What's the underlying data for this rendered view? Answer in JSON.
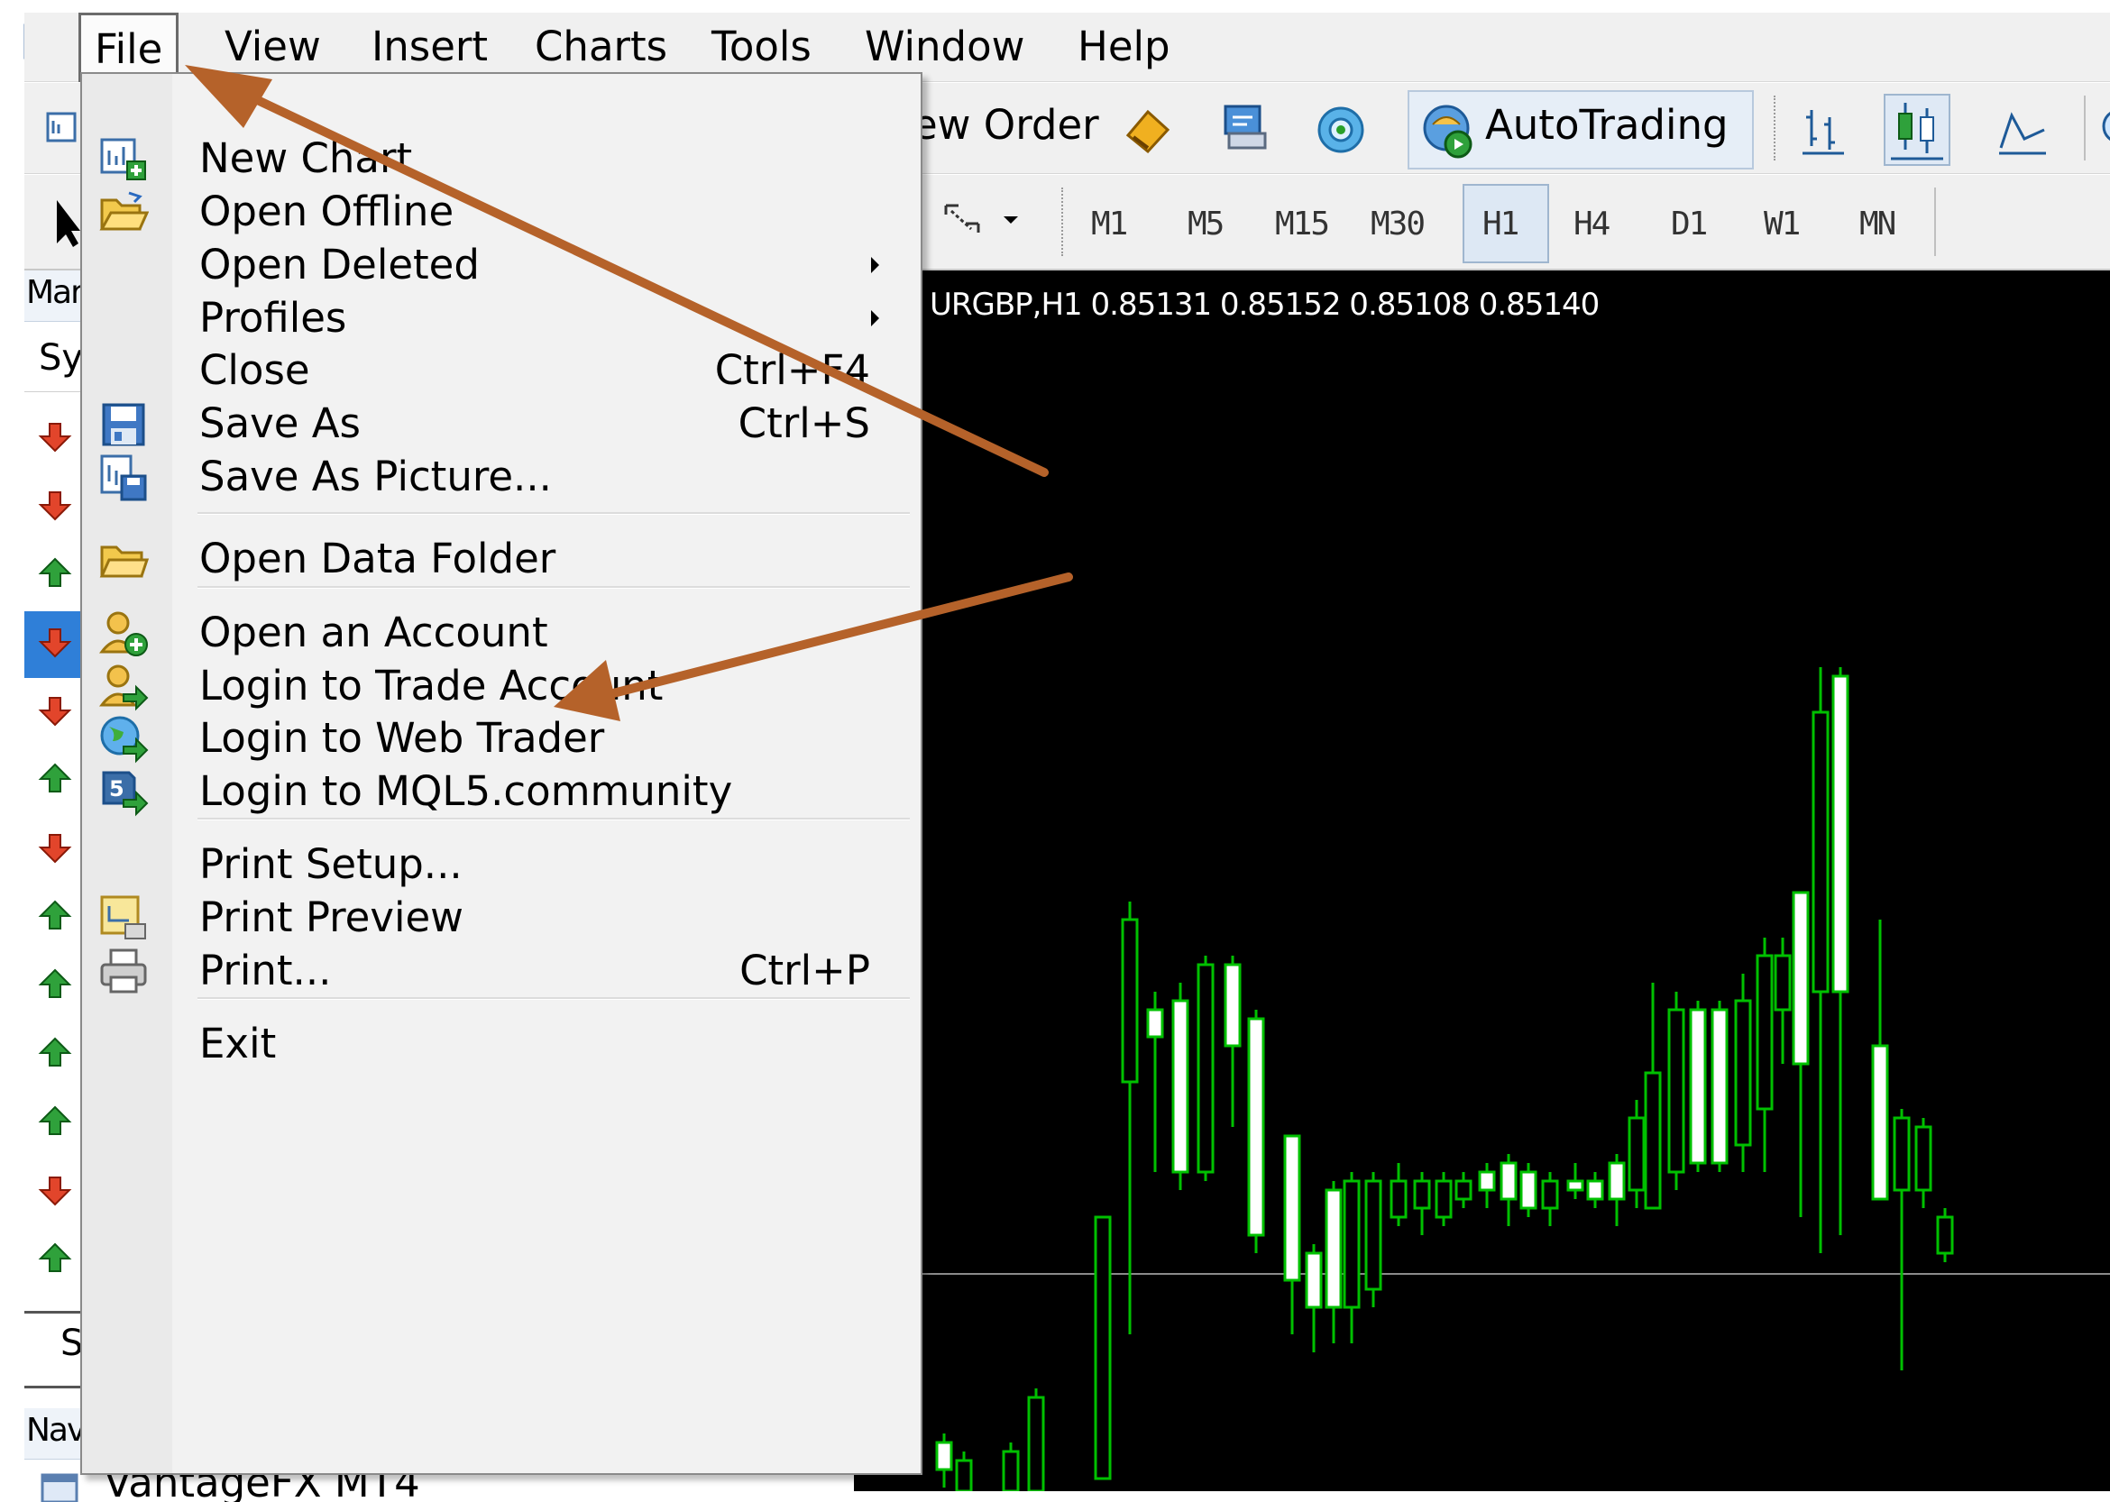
{
  "menubar": {
    "items": [
      "File",
      "View",
      "Insert",
      "Charts",
      "Tools",
      "Window",
      "Help"
    ]
  },
  "toolbar": {
    "new_order_partial": "ew Order",
    "autotrading_label": "AutoTrading",
    "timeframes": [
      "M1",
      "M5",
      "M15",
      "M30",
      "H1",
      "H4",
      "D1",
      "W1",
      "MN"
    ],
    "active_timeframe": "H1"
  },
  "left_panel": {
    "market_watch_partial": "Mar",
    "symbol_header_partial": "Sy",
    "search_partial": "S",
    "navigator_partial": "Nav",
    "navigator_item_partial": "VantageFX MT4",
    "rows": [
      "down",
      "down",
      "up",
      "down",
      "down",
      "up",
      "down",
      "up",
      "up",
      "up",
      "up",
      "down",
      "up"
    ]
  },
  "chart": {
    "info": "URGBP,H1  0.85131 0.85152 0.85108 0.85140",
    "background_color": "#000000",
    "candle_color": "#00c000"
  },
  "file_menu": {
    "items": [
      {
        "label": "New Chart",
        "shortcut": "",
        "icon": "new-chart-icon"
      },
      {
        "label": "Open Offline",
        "shortcut": "",
        "icon": "open-folder-icon"
      },
      {
        "label": "Open Deleted",
        "shortcut": "",
        "submenu": true
      },
      {
        "label": "Profiles",
        "shortcut": "",
        "submenu": true
      },
      {
        "label": "Close",
        "shortcut": "Ctrl+F4"
      },
      {
        "label": "Save As",
        "shortcut": "Ctrl+S",
        "icon": "floppy-disk-icon"
      },
      {
        "label": "Save As Picture...",
        "shortcut": "",
        "icon": "save-picture-icon"
      },
      {
        "label": "Open Data Folder",
        "shortcut": "",
        "icon": "folder-icon"
      },
      {
        "label": "Open an Account",
        "shortcut": "",
        "icon": "user-add-icon"
      },
      {
        "label": "Login to Trade Account",
        "shortcut": "",
        "icon": "user-login-icon"
      },
      {
        "label": "Login to Web Trader",
        "shortcut": "",
        "icon": "globe-icon"
      },
      {
        "label": "Login to MQL5.community",
        "shortcut": "",
        "icon": "mql5-icon"
      },
      {
        "label": "Print Setup...",
        "shortcut": ""
      },
      {
        "label": "Print Preview",
        "shortcut": "",
        "icon": "print-preview-icon"
      },
      {
        "label": "Print...",
        "shortcut": "Ctrl+P",
        "icon": "printer-icon"
      },
      {
        "label": "Exit",
        "shortcut": ""
      }
    ]
  },
  "annotation": {
    "arrow_color": "#b5622a"
  }
}
